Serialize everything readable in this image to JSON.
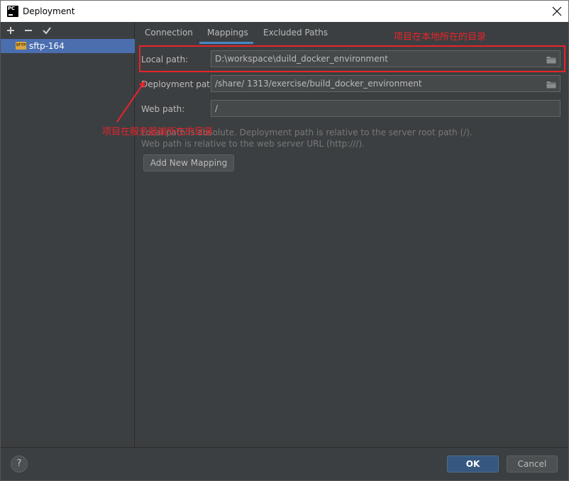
{
  "window": {
    "title": "Deployment",
    "app_logo_text": "PC"
  },
  "toolbar": {
    "add_icon": "plus-icon",
    "remove_icon": "minus-icon",
    "check_icon": "check-icon"
  },
  "servers": [
    {
      "label": "sftp-164",
      "icon_text": "SFTP",
      "selected": true
    }
  ],
  "tabs": [
    {
      "label": "Connection",
      "active": false
    },
    {
      "label": "Mappings",
      "active": true
    },
    {
      "label": "Excluded Paths",
      "active": false
    }
  ],
  "mapping": {
    "local_label": "Local path:",
    "local_value": "D:\\workspace\\duild_docker_environment",
    "deploy_label": "Deployment path:",
    "deploy_value": "/share/    1313/exercise/build_docker_environment",
    "web_label": "Web path:",
    "web_value": "/",
    "hint1": "Local path is absolute. Deployment path is relative to the server root path (/).",
    "hint2": "Web path is relative to the web server URL (http:///).",
    "add_button": "Add New Mapping"
  },
  "annotations": {
    "local_note": "项目在本地所在的目录",
    "server_note": "项目在服务器端所在的目录",
    "color": "#e8232a"
  },
  "footer": {
    "help": "?",
    "ok": "OK",
    "cancel": "Cancel"
  },
  "colors": {
    "accent": "#4a88c7",
    "selection": "#4b6eaf",
    "background": "#3c3f41"
  }
}
